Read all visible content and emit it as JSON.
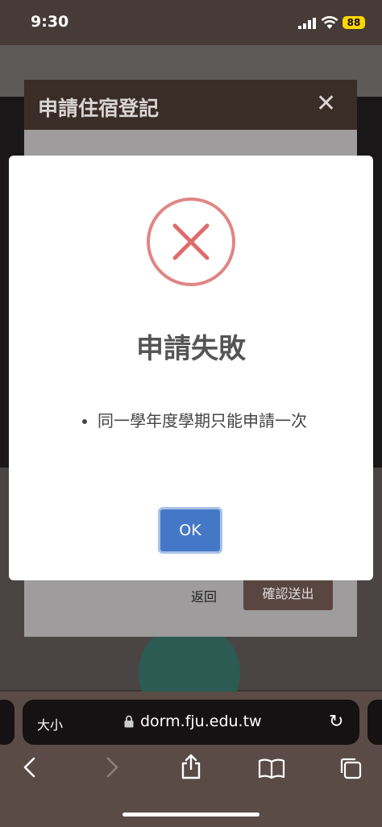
{
  "status": {
    "time": "9:30",
    "battery": "88"
  },
  "background_dialog": {
    "title": "申請住宿登記",
    "back_label": "返回",
    "confirm_label": "確認送出"
  },
  "alert": {
    "title": "申請失敗",
    "messages": [
      "同一學年度學期只能申請一次"
    ],
    "ok_label": "OK",
    "icon": "error-x-icon",
    "icon_color": "#e08585"
  },
  "browser": {
    "text_size_label": "大小",
    "url": "dorm.fju.edu.tw"
  }
}
